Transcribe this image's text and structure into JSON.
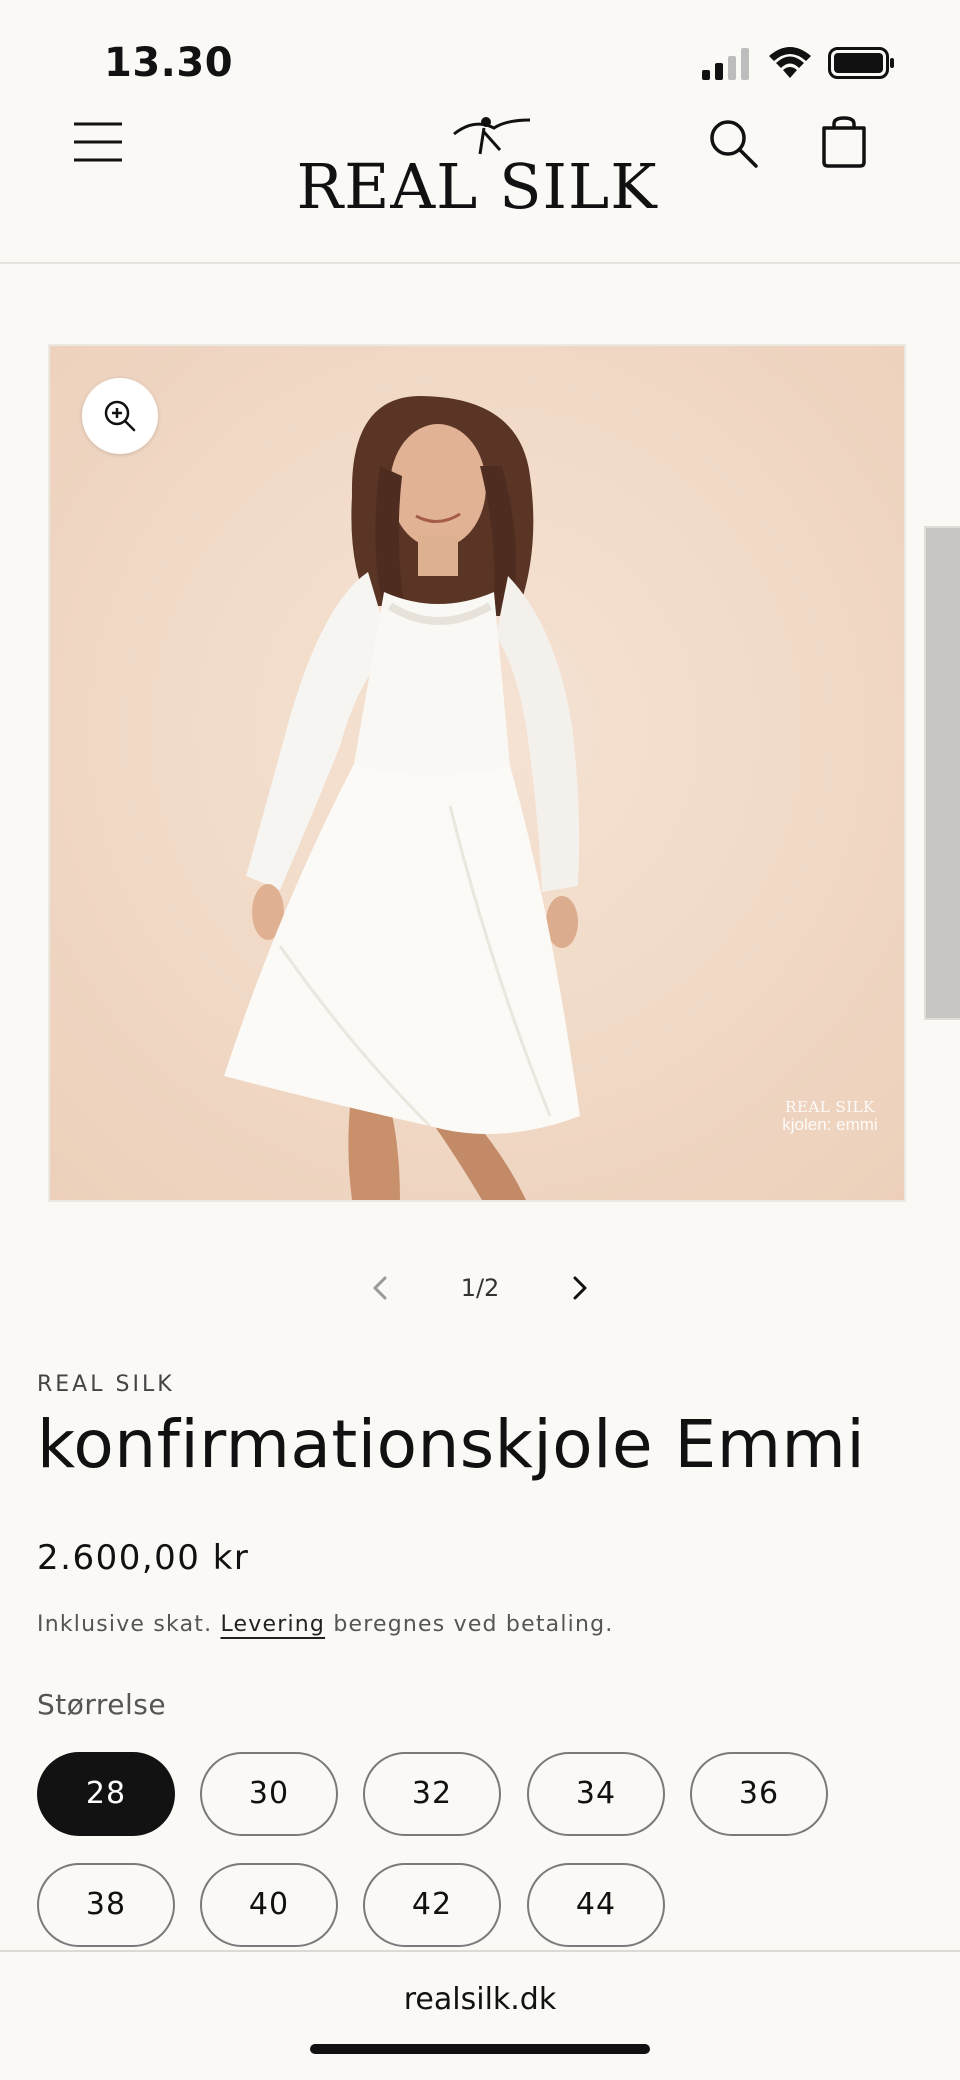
{
  "status": {
    "time": "13.30"
  },
  "header": {
    "logo_text": "REAL SILK"
  },
  "gallery": {
    "watermark_brand": "REAL SILK",
    "watermark_caption": "kjolen: emmi",
    "counter": "1/2"
  },
  "product": {
    "vendor": "REAL SILK",
    "title": "konfirmationskjole Emmi",
    "price": "2.600,00 kr",
    "tax_prefix": "Inklusive skat.",
    "tax_link": "Levering",
    "tax_suffix": "beregnes ved betaling.",
    "size_label": "Størrelse",
    "sizes": [
      "28",
      "30",
      "32",
      "34",
      "36",
      "38",
      "40",
      "42",
      "44"
    ],
    "selected_size": "28"
  },
  "browser": {
    "url": "realsilk.dk"
  },
  "colors": {
    "accent": "#121212",
    "background": "#faf9f6",
    "image_bg": "#f1d8c4"
  }
}
